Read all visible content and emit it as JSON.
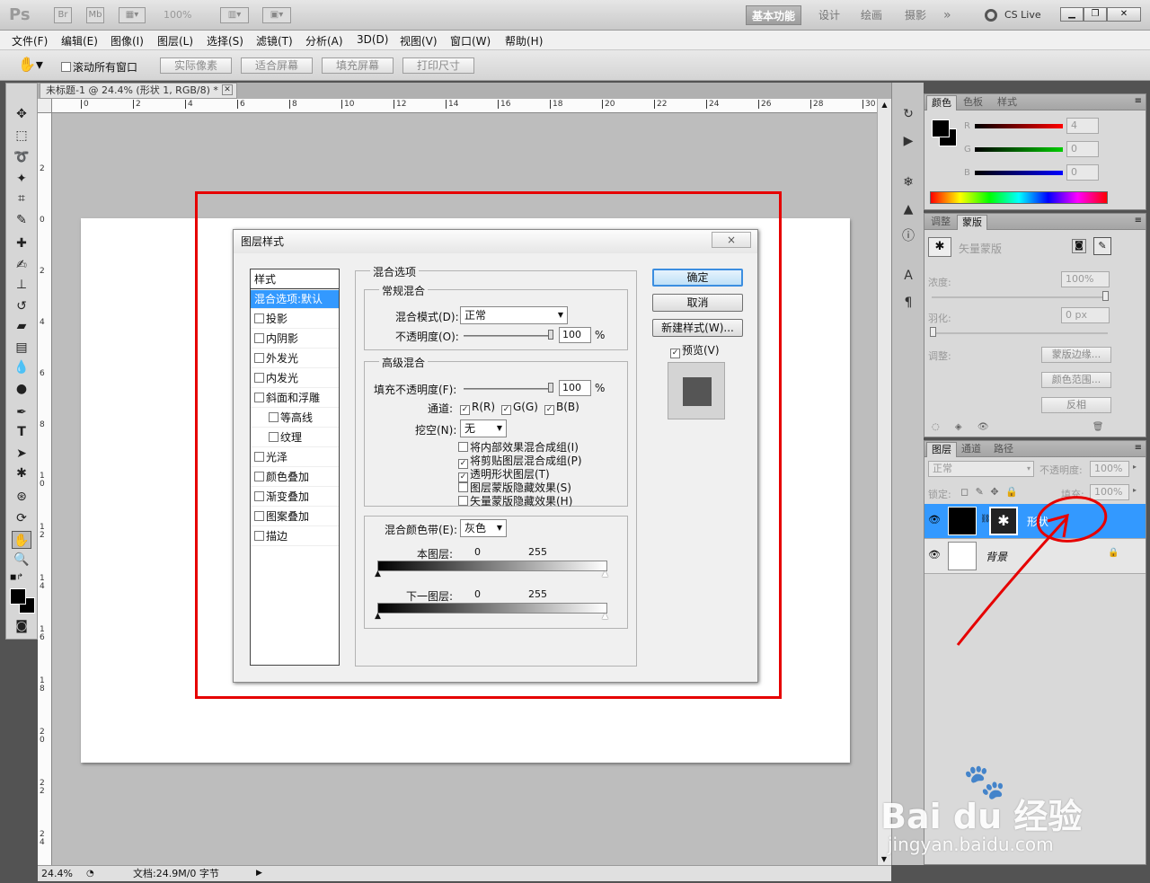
{
  "appbar": {
    "logo": "Ps",
    "br": "Br",
    "mb": "Mb",
    "zoom_select": "100%",
    "workspaces": [
      "基本功能",
      "设计",
      "绘画",
      "摄影"
    ],
    "more": "»",
    "cslive": "CS Live"
  },
  "menu": [
    "文件(F)",
    "编辑(E)",
    "图像(I)",
    "图层(L)",
    "选择(S)",
    "滤镜(T)",
    "分析(A)",
    "3D(D)",
    "视图(V)",
    "窗口(W)",
    "帮助(H)"
  ],
  "options": {
    "scroll_all": "滚动所有窗口",
    "buttons": [
      "实际像素",
      "适合屏幕",
      "填充屏幕",
      "打印尺寸"
    ]
  },
  "document": {
    "tab_title": "未标题-1 @ 24.4% (形状 1, RGB/8) *",
    "ruler_h": [
      "0",
      "2",
      "4",
      "6",
      "8",
      "10",
      "12",
      "14",
      "16",
      "18",
      "20",
      "22",
      "24",
      "26",
      "28",
      "30"
    ],
    "ruler_v": [
      "2",
      "0",
      "2",
      "4",
      "6",
      "8",
      "1 0",
      "1 2",
      "1 4",
      "1 6",
      "1 8",
      "2 0",
      "2 2",
      "2 4"
    ],
    "zoom": "24.4%",
    "doc_info": "文档:24.9M/0 字节"
  },
  "dialog": {
    "title": "图层样式",
    "list_header": "样式",
    "list_items": [
      {
        "label": "混合选项:默认",
        "selected": true,
        "checkbox": false,
        "indent": false
      },
      {
        "label": "投影",
        "checkbox": true,
        "indent": false
      },
      {
        "label": "内阴影",
        "checkbox": true,
        "indent": false
      },
      {
        "label": "外发光",
        "checkbox": true,
        "indent": false
      },
      {
        "label": "内发光",
        "checkbox": true,
        "indent": false
      },
      {
        "label": "斜面和浮雕",
        "checkbox": true,
        "indent": false
      },
      {
        "label": "等高线",
        "checkbox": true,
        "indent": true
      },
      {
        "label": "纹理",
        "checkbox": true,
        "indent": true
      },
      {
        "label": "光泽",
        "checkbox": true,
        "indent": false
      },
      {
        "label": "颜色叠加",
        "checkbox": true,
        "indent": false
      },
      {
        "label": "渐变叠加",
        "checkbox": true,
        "indent": false
      },
      {
        "label": "图案叠加",
        "checkbox": true,
        "indent": false
      },
      {
        "label": "描边",
        "checkbox": true,
        "indent": false
      }
    ],
    "blend_section": "混合选项",
    "general_blend": "常规混合",
    "blend_mode_label": "混合模式(D):",
    "blend_mode_value": "正常",
    "opacity_label": "不透明度(O):",
    "opacity_value": "100",
    "percent": "%",
    "advanced_blend": "高级混合",
    "fill_opacity_label": "填充不透明度(F):",
    "fill_opacity_value": "100",
    "channels_label": "通道:",
    "channels": [
      "R(R)",
      "G(G)",
      "B(B)"
    ],
    "knockout_label": "挖空(N):",
    "knockout_value": "无",
    "options": [
      {
        "label": "将内部效果混合成组(I)",
        "checked": false
      },
      {
        "label": "将剪贴图层混合成组(P)",
        "checked": true
      },
      {
        "label": "透明形状图层(T)",
        "checked": true
      },
      {
        "label": "图层蒙版隐藏效果(S)",
        "checked": false
      },
      {
        "label": "矢量蒙版隐藏效果(H)",
        "checked": false
      }
    ],
    "blend_if_label": "混合颜色带(E):",
    "blend_if_value": "灰色",
    "this_layer": "本图层:",
    "underlying": "下一图层:",
    "range_min": "0",
    "range_max": "255",
    "ok": "确定",
    "cancel": "取消",
    "new_style": "新建样式(W)...",
    "preview": "预览(V)",
    "close_symbol": "×"
  },
  "color_panel": {
    "tabs": [
      "颜色",
      "色板",
      "样式"
    ],
    "r_label": "R",
    "g_label": "G",
    "b_label": "B",
    "r_value": "4",
    "g_value": "0",
    "b_value": "0"
  },
  "masks_panel": {
    "tabs": [
      "调整",
      "蒙版"
    ],
    "title": "矢量蒙版",
    "density_label": "浓度:",
    "density_value": "100%",
    "feather_label": "羽化:",
    "feather_value": "0 px",
    "refine_label": "调整:",
    "buttons": [
      "蒙版边缘...",
      "颜色范围...",
      "反相"
    ]
  },
  "layers_panel": {
    "tabs": [
      "图层",
      "通道",
      "路径"
    ],
    "blend_mode": "正常",
    "opacity_label": "不透明度:",
    "opacity_value": "100%",
    "lock_label": "锁定:",
    "fill_label": "填充:",
    "fill_value": "100%",
    "layers": [
      {
        "name": "形状",
        "type": "shape",
        "selected": true
      },
      {
        "name": "背景",
        "type": "background",
        "selected": false
      }
    ],
    "fx": "fx"
  },
  "watermark": {
    "brand": "Bai du 经验",
    "url": "jingyan.baidu.com"
  },
  "colors": {
    "selection": "#3399ff",
    "annotation": "#e60000",
    "default_button": "#3c8ee0"
  }
}
